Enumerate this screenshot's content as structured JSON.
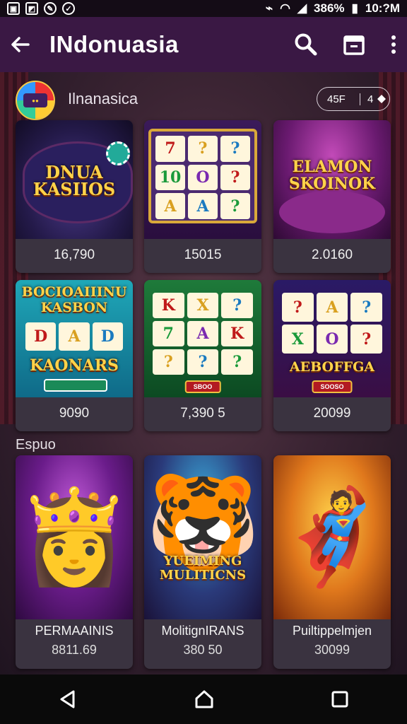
{
  "status": {
    "battery": "386%",
    "time": "10:?M"
  },
  "appbar": {
    "title": "INdonuasia",
    "icons": [
      "back-arrow-icon",
      "search-icon",
      "cabinet-icon",
      "more-vertical-icon"
    ]
  },
  "section1": {
    "title": "Ilnanasica",
    "chip_left": "45F",
    "chip_right": "4"
  },
  "grid": [
    {
      "art_text": "DNUA KASIIOS",
      "value": "16,790"
    },
    {
      "art_text": "",
      "reels": [
        "7",
        "?",
        "?",
        "10",
        "O",
        "?",
        "A",
        "A",
        "?"
      ],
      "value": "15015"
    },
    {
      "art_text": "ELAMON SKOINOK",
      "value": "2.0160"
    },
    {
      "art_text": "BOCIOAIIINU KASBON",
      "reels": [
        "D",
        "A",
        "D"
      ],
      "banner": "KAONARS",
      "value": "9090"
    },
    {
      "reels": [
        "K",
        "X",
        "?",
        "7",
        "A",
        "K",
        "?",
        "?",
        "?"
      ],
      "sub": "SBOO",
      "value": "7,390 5"
    },
    {
      "reels": [
        "?",
        "A",
        "?",
        "X",
        "O",
        "?"
      ],
      "banner": "AEBOFFGA",
      "sub": "SOOSO",
      "value": "20099"
    }
  ],
  "section2": {
    "title": "Espuo"
  },
  "characters": [
    {
      "name": "PERMAAINIS",
      "value": "8811.69",
      "emoji": "👸"
    },
    {
      "name": "MolitignIRANS",
      "value": "380 50",
      "emoji": "🐯",
      "art_text": "YUEIMING MULITICNS"
    },
    {
      "name": "Puiltippelmjen",
      "value": "30099",
      "emoji": "🦸"
    }
  ],
  "colors": {
    "appbar": "#3a1844",
    "card": "#3a3340",
    "gold": "#ffd34a"
  }
}
